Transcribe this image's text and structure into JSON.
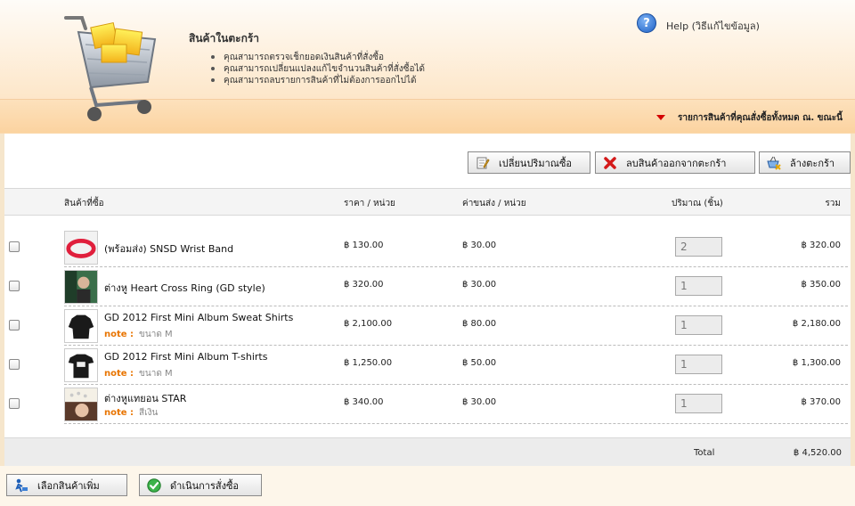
{
  "header": {
    "title": "สินค้าในตะกร้า",
    "bullets": [
      "คุณสามารถตรวจเช็กยอดเงินสินค้าที่สั่งซื้อ",
      "คุณสามารถเปลี่ยนแปลงแก้ไขจำนวนสินค้าที่สั่งซื้อได้",
      "คุณสามารถลบรายการสินค้าที่ไม่ต้องการออกไปได้"
    ],
    "help_label": "Help (วิธีแก้ไขข้อมูล)",
    "band_text": "รายการสินค้าที่คุณสั่งซื้อทั้งหมด ณ. ขณะนี้"
  },
  "toolbar": {
    "update_qty": "เปลี่ยนปริมาณซื้อ",
    "remove_item": "ลบสินค้าออกจากตะกร้า",
    "clear_cart": "ล้างตะกร้า"
  },
  "table": {
    "columns": {
      "product": "สินค้าที่ซื้อ",
      "price": "ราคา / หน่วย",
      "shipping": "ค่าขนส่ง / หน่วย",
      "quantity": "ปริมาณ (ชิ้น)",
      "total": "รวม"
    },
    "rows": [
      {
        "name": "(พร้อมส่ง) SNSD Wrist Band",
        "note_label": "",
        "note_value": "",
        "price": "฿ 130.00",
        "shipping": "฿ 30.00",
        "qty": "2",
        "total": "฿ 320.00"
      },
      {
        "name": "ต่างหู Heart Cross Ring (GD style)",
        "note_label": "",
        "note_value": "",
        "price": "฿ 320.00",
        "shipping": "฿ 30.00",
        "qty": "1",
        "total": "฿ 350.00"
      },
      {
        "name": "GD 2012 First Mini Album Sweat Shirts",
        "note_label": "note :",
        "note_value": "ขนาด M",
        "price": "฿ 2,100.00",
        "shipping": "฿ 80.00",
        "qty": "1",
        "total": "฿ 2,180.00"
      },
      {
        "name": "GD 2012 First Mini Album T-shirts",
        "note_label": "note :",
        "note_value": "ขนาด M",
        "price": "฿ 1,250.00",
        "shipping": "฿ 50.00",
        "qty": "1",
        "total": "฿ 1,300.00"
      },
      {
        "name": "ต่างหูแทยอน STAR",
        "note_label": "note :",
        "note_value": "สีเงิน",
        "price": "฿ 340.00",
        "shipping": "฿ 30.00",
        "qty": "1",
        "total": "฿ 370.00"
      }
    ],
    "footer": {
      "label": "Total",
      "value": "฿ 4,520.00"
    }
  },
  "bottom": {
    "continue_shopping": "เลือกสินค้าเพิ่ม",
    "checkout": "ดำเนินการสั่งซื้อ"
  },
  "colors": {
    "note_label": "#e87400",
    "band_arrow": "#d40000",
    "header_bg": "#fde6c8"
  }
}
